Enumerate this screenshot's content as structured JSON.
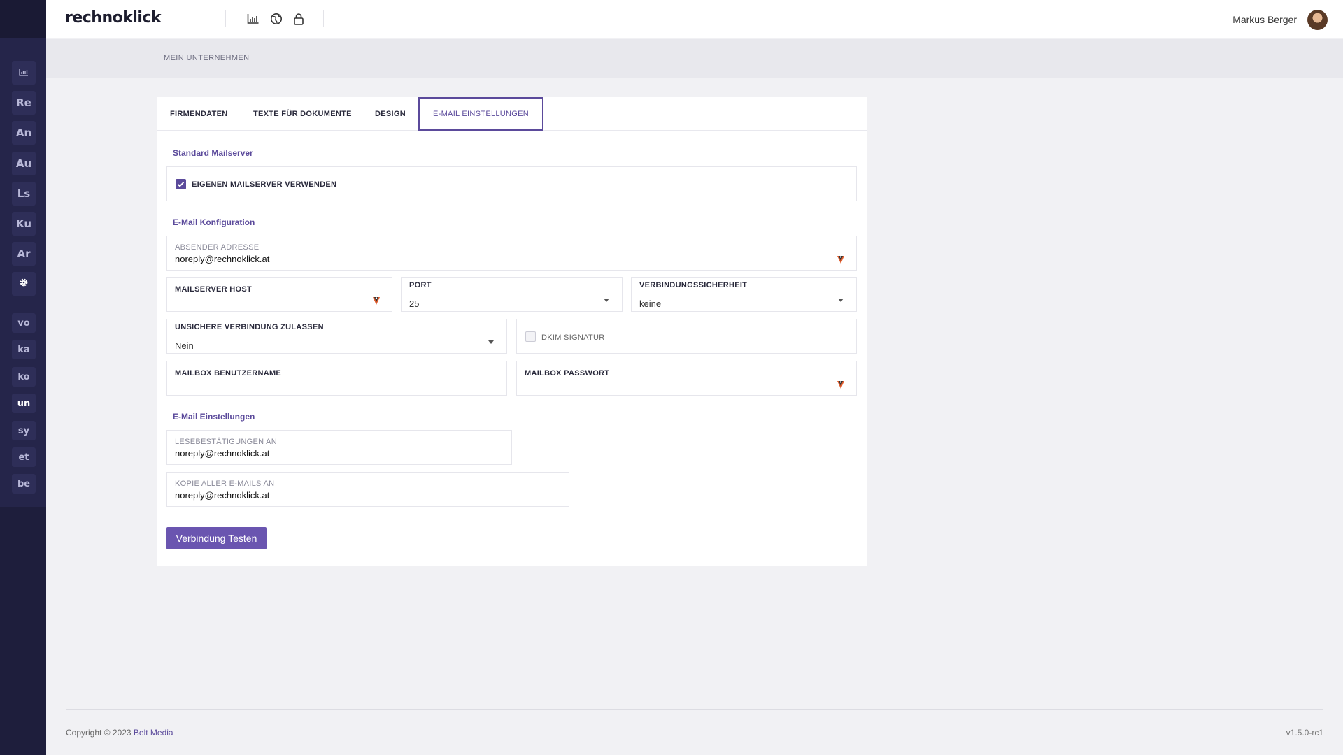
{
  "app": {
    "logo": "rechnoklick"
  },
  "header": {
    "user_name": "Markus Berger"
  },
  "sidebar": {
    "items": [
      {
        "label": "",
        "icon": "chart-icon"
      },
      {
        "label": "Re"
      },
      {
        "label": "An"
      },
      {
        "label": "Au"
      },
      {
        "label": "Ls"
      },
      {
        "label": "Ku"
      },
      {
        "label": "Ar"
      },
      {
        "label": "",
        "icon": "gear-icon"
      },
      {
        "label": "vo"
      },
      {
        "label": "ka"
      },
      {
        "label": "ko"
      },
      {
        "label": "un"
      },
      {
        "label": "sy"
      },
      {
        "label": "et"
      },
      {
        "label": "be"
      }
    ]
  },
  "breadcrumb": "MEIN UNTERNEHMEN",
  "tabs": [
    {
      "label": "FIRMENDATEN"
    },
    {
      "label": "TEXTE FÜR DOKUMENTE"
    },
    {
      "label": "DESIGN"
    },
    {
      "label": "E-MAIL EINSTELLUNGEN",
      "active": true
    }
  ],
  "sections": {
    "standard": {
      "title": "Standard Mailserver",
      "own_mailserver_label": "EIGENEN MAILSERVER VERWENDEN",
      "own_mailserver_checked": true
    },
    "config": {
      "title": "E-Mail Konfiguration",
      "sender_label": "ABSENDER ADRESSE",
      "sender_value": "noreply@rechnoklick.at",
      "host_label": "MAILSERVER HOST",
      "host_value": "",
      "port_label": "PORT",
      "port_value": "25",
      "security_label": "VERBINDUNGSSICHERHEIT",
      "security_value": "keine",
      "insecure_label": "UNSICHERE VERBINDUNG ZULASSEN",
      "insecure_value": "Nein",
      "dkim_label": "DKIM SIGNATUR",
      "dkim_checked": false,
      "user_label": "MAILBOX BENUTZERNAME",
      "user_value": "",
      "password_label": "MAILBOX PASSWORT",
      "password_value": ""
    },
    "settings": {
      "title": "E-Mail Einstellungen",
      "read_receipt_label": "LESEBESTÄTIGUNGEN AN",
      "read_receipt_value": "noreply@rechnoklick.at",
      "copy_label": "KOPIE ALLER E-MAILS AN",
      "copy_value": "noreply@rechnoklick.at"
    }
  },
  "test_button": "Verbindung Testen",
  "footer": {
    "copyright": "Copyright © 2023",
    "brand": "Belt Media",
    "version": "v1.5.0-rc1"
  },
  "colors": {
    "accent": "#5b4a9b",
    "sidebar": "#1e1e3c",
    "button": "#6a55b0"
  }
}
